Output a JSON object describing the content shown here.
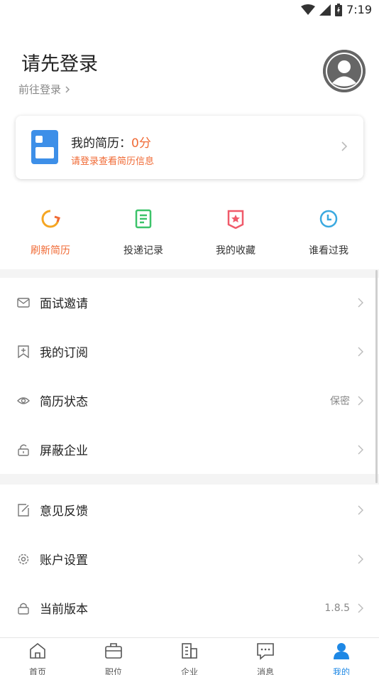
{
  "status_bar": {
    "time": "7:19"
  },
  "header": {
    "title": "请先登录",
    "login_link": "前往登录"
  },
  "resume_card": {
    "title_prefix": "我的简历：",
    "score": "0分",
    "hint": "请登录查看简历信息"
  },
  "quick_actions": [
    {
      "label": "刷新简历",
      "icon": "refresh-icon",
      "color": "#f5a623"
    },
    {
      "label": "投递记录",
      "icon": "document-icon",
      "color": "#3cc36a"
    },
    {
      "label": "我的收藏",
      "icon": "favorite-badge-icon",
      "color": "#f05a6a"
    },
    {
      "label": "谁看过我",
      "icon": "clock-icon",
      "color": "#3aa9e0"
    }
  ],
  "menu_group_1": [
    {
      "label": "面试邀请",
      "icon": "mail-icon",
      "value": ""
    },
    {
      "label": "我的订阅",
      "icon": "bookmark-add-icon",
      "value": ""
    },
    {
      "label": "简历状态",
      "icon": "eye-icon",
      "value": "保密"
    },
    {
      "label": "屏蔽企业",
      "icon": "unlock-icon",
      "value": ""
    }
  ],
  "menu_group_2": [
    {
      "label": "意见反馈",
      "icon": "edit-icon",
      "value": ""
    },
    {
      "label": "账户设置",
      "icon": "gear-icon",
      "value": ""
    },
    {
      "label": "当前版本",
      "icon": "lock-icon",
      "value": "1.8.5"
    }
  ],
  "tab_bar": [
    {
      "label": "首页",
      "icon": "home-icon"
    },
    {
      "label": "职位",
      "icon": "briefcase-icon"
    },
    {
      "label": "企业",
      "icon": "building-icon"
    },
    {
      "label": "消息",
      "icon": "message-icon"
    },
    {
      "label": "我的",
      "icon": "user-icon",
      "active": true
    }
  ],
  "colors": {
    "accent_orange": "#f06a35",
    "tab_active_blue": "#1e88e5",
    "resume_icon_blue": "#3d8fe8"
  }
}
